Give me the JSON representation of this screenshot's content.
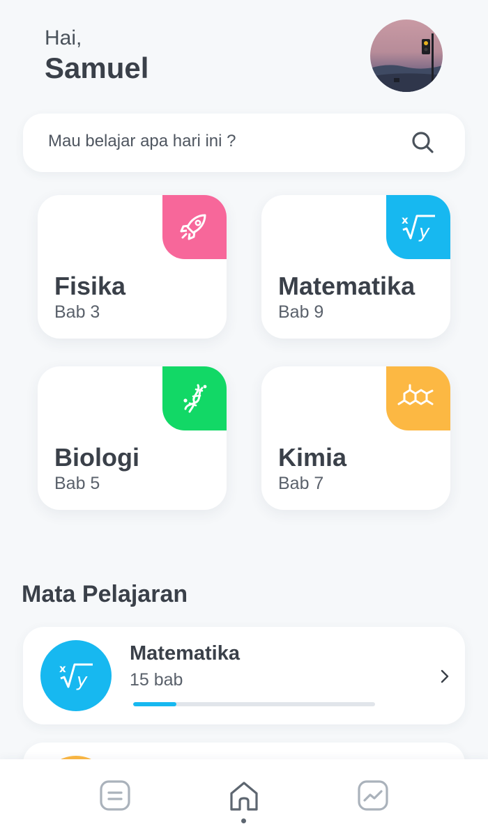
{
  "header": {
    "greeting": "Hai,",
    "name": "Samuel"
  },
  "search": {
    "placeholder": "Mau belajar apa hari ini ?"
  },
  "cards": [
    {
      "title": "Fisika",
      "subtitle": "Bab 3",
      "icon": "rocket-icon",
      "color": "#f7679a"
    },
    {
      "title": "Matematika",
      "subtitle": "Bab 9",
      "icon": "root-formula-icon",
      "color": "#17b8f0"
    },
    {
      "title": "Biologi",
      "subtitle": "Bab 5",
      "icon": "dna-icon",
      "color": "#12d866"
    },
    {
      "title": "Kimia",
      "subtitle": "Bab 7",
      "icon": "molecule-icon",
      "color": "#fcb843"
    }
  ],
  "section": {
    "title": "Mata Pelajaran"
  },
  "subjects": [
    {
      "title": "Matematika",
      "subtitle": "15 bab",
      "progress": 0.18,
      "icon": "root-formula-icon",
      "color": "#17b8f0"
    }
  ],
  "nav": {
    "items": [
      "list-icon",
      "home-icon",
      "chart-icon"
    ],
    "active": "home-icon"
  }
}
